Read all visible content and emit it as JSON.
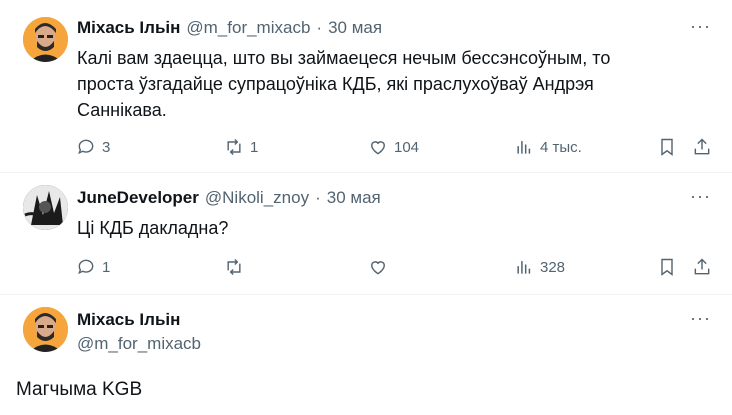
{
  "tweets": [
    {
      "author": "Міхась Ільін",
      "handle": "@m_for_mixacb",
      "separator": "·",
      "date": "30 мая",
      "text_lines": [
        "Калі вам здаецца, што вы займаецеся нечым бессэнсоўным, то",
        "проста ўзгадайце супрацоўніка КДБ, які праслухоўваў Андрэя",
        "Саннікава."
      ],
      "more": "···",
      "replies": "3",
      "retweets": "1",
      "likes": "104",
      "views": "4 тыс."
    },
    {
      "author": "JuneDeveloper",
      "handle": "@Nikoli_znoy",
      "separator": "·",
      "date": "30 мая",
      "text_lines": [
        "Ці КДБ дакладна?"
      ],
      "more": "···",
      "replies": "1",
      "retweets": "",
      "likes": "",
      "views": "328"
    }
  ],
  "main_tweet": {
    "author": "Міхась Ільін",
    "handle": "@m_for_mixacb",
    "more": "···",
    "text": "Магчыма KGB"
  },
  "colors": {
    "text": "#0f1419",
    "muted": "#536471",
    "avatar_orange": "#f6a53c"
  }
}
